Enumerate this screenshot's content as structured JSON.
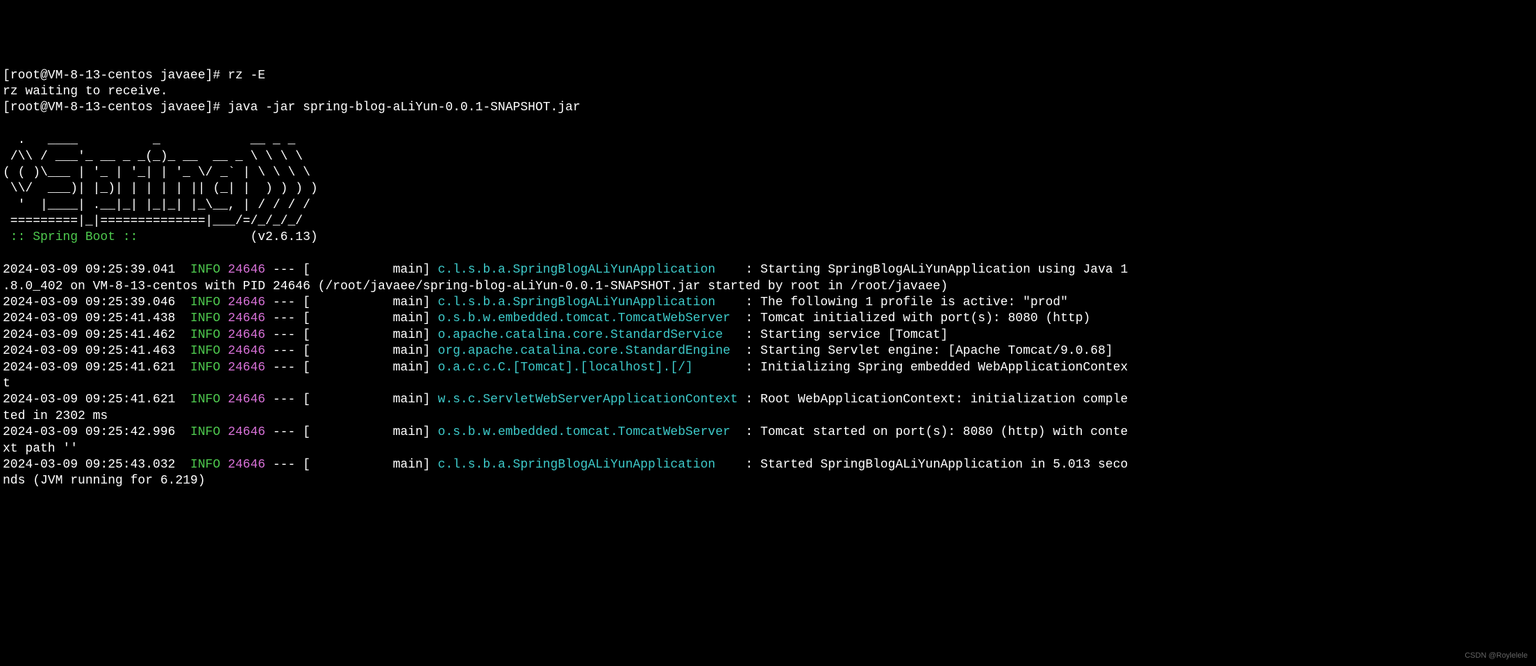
{
  "prompts": [
    {
      "host": "[root@VM-8-13-centos javaee]# ",
      "cmd": "rz -E"
    },
    {
      "text": "rz waiting to receive."
    },
    {
      "host": "[root@VM-8-13-centos javaee]# ",
      "cmd": "java -jar spring-blog-aLiYun-0.0.1-SNAPSHOT.jar"
    }
  ],
  "banner": {
    "line1": "  .   ____          _            __ _ _",
    "line2": " /\\\\ / ___'_ __ _ _(_)_ __  __ _ \\ \\ \\ \\",
    "line3": "( ( )\\___ | '_ | '_| | '_ \\/ _` | \\ \\ \\ \\",
    "line4": " \\\\/  ___)| |_)| | | | | || (_| |  ) ) ) )",
    "line5": "  '  |____| .__|_| |_|_| |_\\__, | / / / /",
    "line6": " =========|_|==============|___/=/_/_/_/",
    "springboot": " :: Spring Boot ::               ",
    "version": "(v2.6.13)"
  },
  "logs": [
    {
      "ts": "2024-03-09 09:25:39.041",
      "level": "INFO",
      "pid": "24646",
      "sep": " --- [           main] ",
      "logger": "c.l.s.b.a.SpringBlogALiYunApplication",
      "pad": "    ",
      "msg": ": Starting SpringBlogALiYunApplication using Java 1.8.0_402 on VM-8-13-centos with PID 24646 (/root/javaee/spring-blog-aLiYun-0.0.1-SNAPSHOT.jar started by root in /root/javaee)"
    },
    {
      "ts": "2024-03-09 09:25:39.046",
      "level": "INFO",
      "pid": "24646",
      "sep": " --- [           main] ",
      "logger": "c.l.s.b.a.SpringBlogALiYunApplication",
      "pad": "    ",
      "msg": ": The following 1 profile is active: \"prod\""
    },
    {
      "ts": "2024-03-09 09:25:41.438",
      "level": "INFO",
      "pid": "24646",
      "sep": " --- [           main] ",
      "logger": "o.s.b.w.embedded.tomcat.TomcatWebServer",
      "pad": "  ",
      "msg": ": Tomcat initialized with port(s): 8080 (http)"
    },
    {
      "ts": "2024-03-09 09:25:41.462",
      "level": "INFO",
      "pid": "24646",
      "sep": " --- [           main] ",
      "logger": "o.apache.catalina.core.StandardService",
      "pad": "   ",
      "msg": ": Starting service [Tomcat]"
    },
    {
      "ts": "2024-03-09 09:25:41.463",
      "level": "INFO",
      "pid": "24646",
      "sep": " --- [           main] ",
      "logger": "org.apache.catalina.core.StandardEngine",
      "pad": "  ",
      "msg": ": Starting Servlet engine: [Apache Tomcat/9.0.68]"
    },
    {
      "ts": "2024-03-09 09:25:41.621",
      "level": "INFO",
      "pid": "24646",
      "sep": " --- [           main] ",
      "logger": "o.a.c.c.C.[Tomcat].[localhost].[/]",
      "pad": "       ",
      "msg": ": Initializing Spring embedded WebApplicationContext"
    },
    {
      "ts": "2024-03-09 09:25:41.621",
      "level": "INFO",
      "pid": "24646",
      "sep": " --- [           main] ",
      "logger": "w.s.c.ServletWebServerApplicationContext",
      "pad": " ",
      "msg": ": Root WebApplicationContext: initialization completed in 2302 ms"
    },
    {
      "ts": "2024-03-09 09:25:42.996",
      "level": "INFO",
      "pid": "24646",
      "sep": " --- [           main] ",
      "logger": "o.s.b.w.embedded.tomcat.TomcatWebServer",
      "pad": "  ",
      "msg": ": Tomcat started on port(s): 8080 (http) with context path ''"
    },
    {
      "ts": "2024-03-09 09:25:43.032",
      "level": "INFO",
      "pid": "24646",
      "sep": " --- [           main] ",
      "logger": "c.l.s.b.a.SpringBlogALiYunApplication",
      "pad": "    ",
      "msg": ": Started SpringBlogALiYunApplication in 5.013 seconds (JVM running for 6.219)"
    }
  ],
  "watermark": "CSDN @Roylelele"
}
